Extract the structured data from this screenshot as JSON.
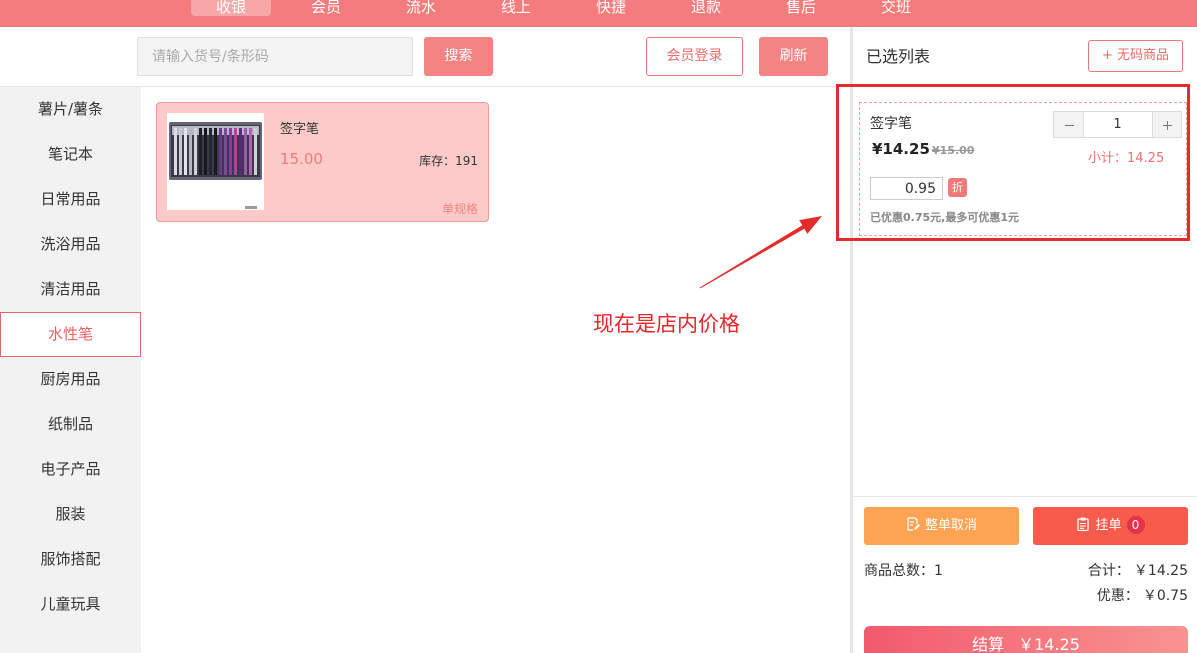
{
  "nav": {
    "items": [
      {
        "label": "收银",
        "active": true
      },
      {
        "label": "会员",
        "active": false
      },
      {
        "label": "流水",
        "active": false
      },
      {
        "label": "线上",
        "active": false
      },
      {
        "label": "快捷",
        "active": false
      },
      {
        "label": "退款",
        "active": false
      },
      {
        "label": "售后",
        "active": false
      },
      {
        "label": "交班",
        "active": false
      }
    ]
  },
  "search": {
    "placeholder": "请输入货号/条形码",
    "button": "搜索"
  },
  "header_actions": {
    "member_login": "会员登录",
    "refresh": "刷新"
  },
  "categories": [
    {
      "label": "薯片/薯条",
      "active": false
    },
    {
      "label": "笔记本",
      "active": false
    },
    {
      "label": "日常用品",
      "active": false
    },
    {
      "label": "洗浴用品",
      "active": false
    },
    {
      "label": "清洁用品",
      "active": false
    },
    {
      "label": "水性笔",
      "active": true
    },
    {
      "label": "厨房用品",
      "active": false
    },
    {
      "label": "纸制品",
      "active": false
    },
    {
      "label": "电子产品",
      "active": false
    },
    {
      "label": "服装",
      "active": false
    },
    {
      "label": "服饰搭配",
      "active": false
    },
    {
      "label": "儿童玩具",
      "active": false
    }
  ],
  "products": [
    {
      "name": "签字笔",
      "price": "15.00",
      "stock_label": "库存：",
      "stock": "191",
      "spec": "单规格"
    }
  ],
  "cart": {
    "title": "已选列表",
    "no_code_button": "+ 无码商品",
    "items": [
      {
        "name": "签字笔",
        "price": "¥14.25",
        "original_price": "¥15.00",
        "qty": "1",
        "subtotal": "小计：14.25",
        "discount": "0.95",
        "discount_badge": "折",
        "discount_note": "已优惠0.75元,最多可优惠1元"
      }
    ],
    "cancel_button": "整单取消",
    "hold_button": "挂单",
    "hold_count": "0",
    "total_count": "商品总数：1",
    "total_label": "合计：",
    "total_value": "￥14.25",
    "discount_label": "优惠：",
    "discount_value": "￥0.75",
    "checkout_label": "结算",
    "checkout_amount": "￥14.25"
  },
  "annotation": {
    "text": "现在是店内价格"
  },
  "icons": {
    "stepper_minus": "minus-icon",
    "stepper_plus": "plus-icon",
    "cancel": "document-edit-icon",
    "hold": "clipboard-icon",
    "product": "pen-set-photo"
  },
  "colors": {
    "nav_bg": "#f47c7c",
    "nav_active": "#f8a7a7",
    "accent": "#f48383",
    "accent_text": "#f06a6a",
    "card_bg": "#fdcaca",
    "cancel_bg": "#fda354",
    "hold_bg": "#f65b4c",
    "checkout_from": "#f25a6c",
    "checkout_to": "#f99391",
    "annotation": "#e52b2b"
  }
}
